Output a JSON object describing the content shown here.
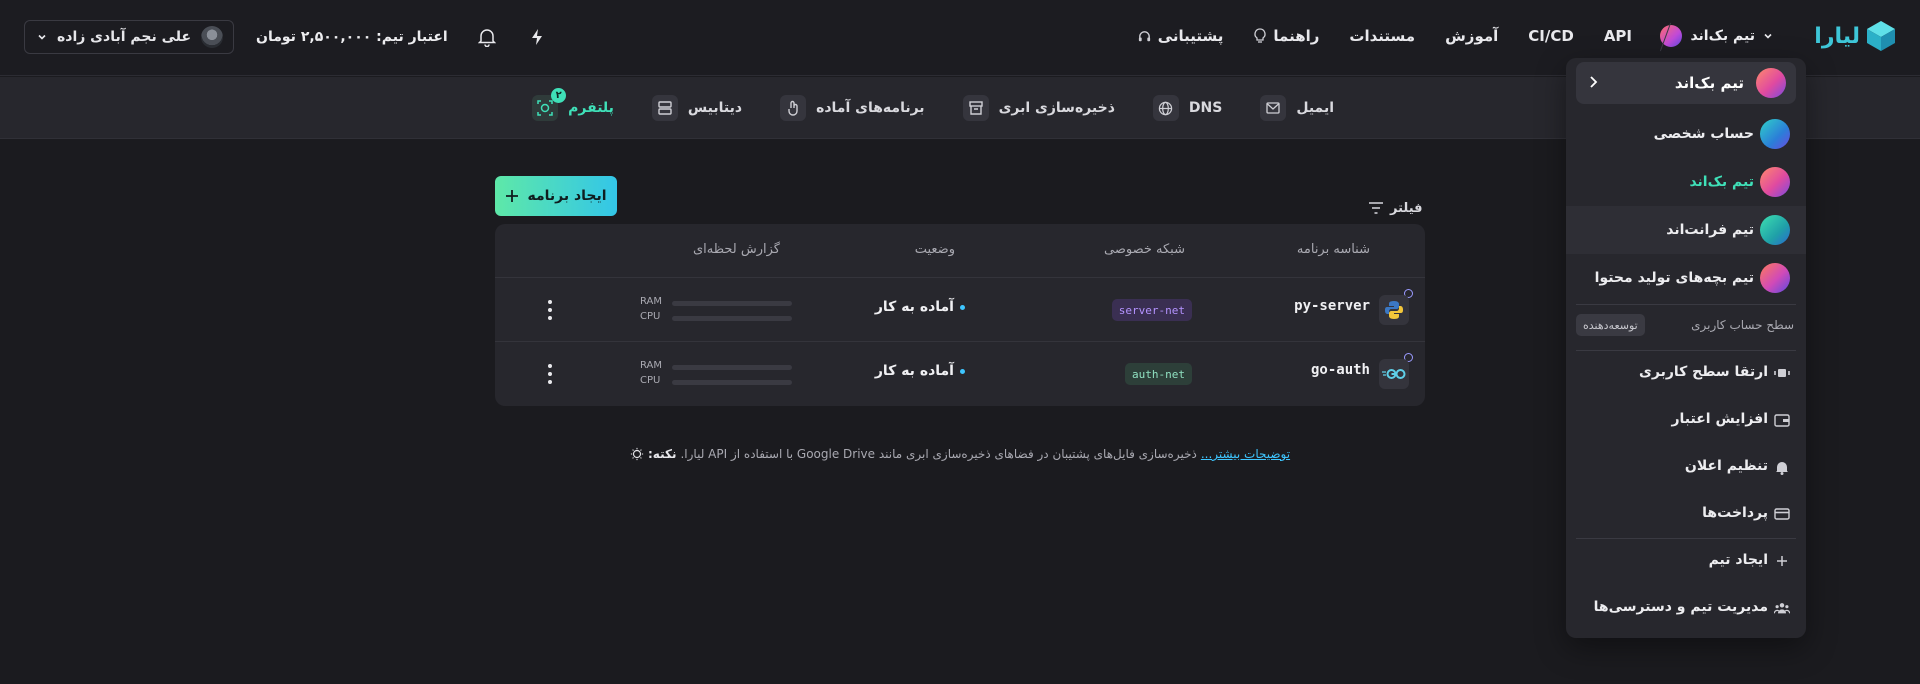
{
  "brand": {
    "name": "لیارا",
    "accent": "#3ec6d8"
  },
  "header": {
    "current_team": "تیم بک‌اند",
    "nav": [
      {
        "label": "پشتیبانی",
        "icon": "headset-icon"
      },
      {
        "label": "راهنما",
        "icon": "lightbulb-icon"
      },
      {
        "label": "مستندات"
      },
      {
        "label": "آموزش"
      },
      {
        "label": "CI/CD"
      },
      {
        "label": "API"
      }
    ],
    "credit_label": "اعتبار تیم:",
    "credit_value": "۲,۵۰۰,۰۰۰ تومان",
    "user_name": "علی نجم آبادی زاده"
  },
  "subnav": {
    "items": [
      {
        "label": "پلتفرم",
        "icon": "platform-icon",
        "badge": "۲",
        "active": true
      },
      {
        "label": "دیتابیس",
        "icon": "database-icon"
      },
      {
        "label": "برنامه‌های آماده",
        "icon": "oneclick-apps-icon"
      },
      {
        "label": "ذخیره‌سازی ابری",
        "icon": "archive-icon"
      },
      {
        "label": "DNS",
        "icon": "globe-icon"
      },
      {
        "label": "ایمیل",
        "icon": "mail-icon"
      }
    ]
  },
  "actions": {
    "create_app": "ایجاد برنامه",
    "filter": "فیلتر"
  },
  "table": {
    "headers": [
      "شناسه برنامه",
      "شبکه خصوصی",
      "وضعیت",
      "گزارش لحظه‌ای"
    ],
    "usage_labels": [
      "RAM",
      "CPU"
    ],
    "rows": [
      {
        "name": "py-server",
        "icon": "python-icon",
        "network": "server-net",
        "status": "آماده به کار"
      },
      {
        "name": "go-auth",
        "icon": "go-icon",
        "network": "auth-net",
        "status": "آماده به کار"
      }
    ]
  },
  "tip": {
    "label": "نکته:",
    "text": "ذخیره‌سازی فایل‌های پشتیبان در فضاهای ذخیره‌سازی ابری مانند Google Drive با استفاده از API لیارا.",
    "link": "توضیحات بیشتر..."
  },
  "dropdown": {
    "current": "تیم بک‌اند",
    "teams": [
      {
        "name": "حساب شخصی"
      },
      {
        "name": "تیم بک‌اند",
        "active": true
      },
      {
        "name": "تیم فرانت‌اند"
      },
      {
        "name": "تیم بچه‌های تولید محتوا"
      }
    ],
    "level_label": "سطح حساب کاربری",
    "level_value": "توسعه‌دهنده",
    "actions": [
      {
        "name": "ارتقا سطح کاربری",
        "icon": "upgrade-icon"
      },
      {
        "name": "افزایش اعتبار",
        "icon": "wallet-icon"
      },
      {
        "name": "تنظیم اعلان",
        "icon": "bell-icon"
      },
      {
        "name": "پرداخت‌ها",
        "icon": "card-icon"
      },
      {
        "name": "ایجاد تیم",
        "icon": "plus-icon"
      },
      {
        "name": "مدیریت تیم و دسترسی‌ها",
        "icon": "users-icon"
      }
    ]
  }
}
